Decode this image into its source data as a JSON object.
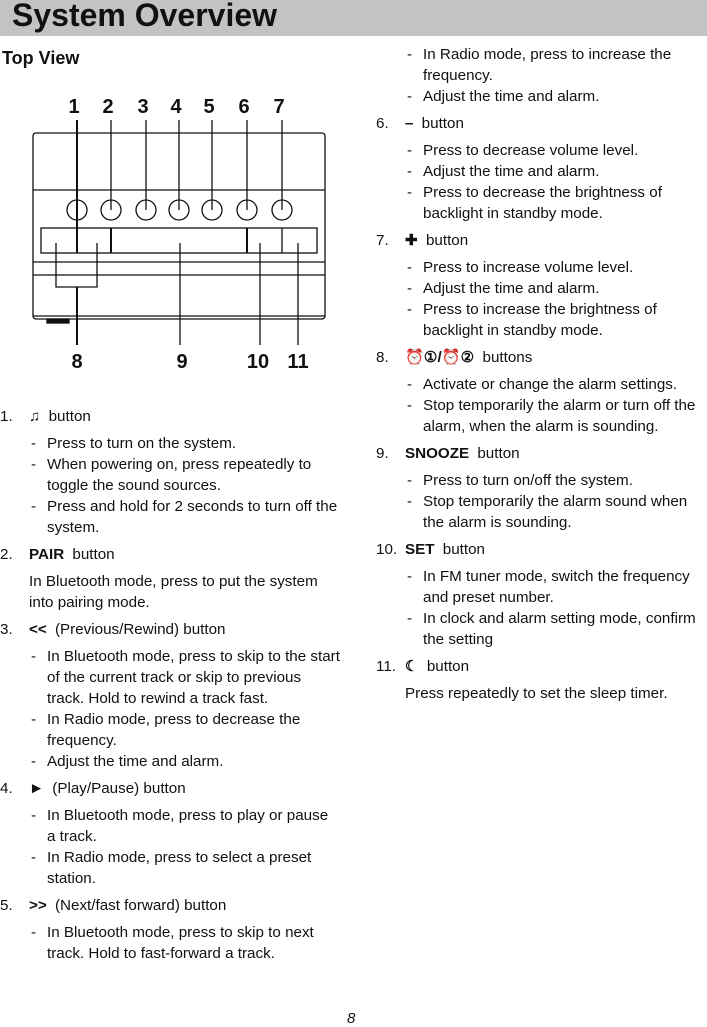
{
  "header": {
    "title": "System Overview"
  },
  "section": "Top View",
  "diagram": {
    "top_labels": [
      "1",
      "2",
      "3",
      "4",
      "5",
      "6",
      "7"
    ],
    "bottom_labels": [
      "8",
      "9",
      "10",
      "11"
    ]
  },
  "items": [
    {
      "num": "1.",
      "icon": "♫",
      "label": " button",
      "subs": [
        "Press to turn on the system.",
        "When powering on, press repeatedly to toggle the sound sources.",
        "Press and hold for 2 seconds to turn off the system."
      ]
    },
    {
      "num": "2.",
      "icon": "PAIR",
      "label": " button",
      "para": "In Bluetooth mode, press to put the system into pairing mode."
    },
    {
      "num": "3.",
      "icon": "<<",
      "label": " (Previous/Rewind) button",
      "subs": [
        "In Bluetooth mode, press to skip to the start of the current track or skip to previous track. Hold to rewind a track fast.",
        "In Radio mode, press to decrease the frequency.",
        "Adjust the time and alarm."
      ]
    },
    {
      "num": "4.",
      "icon": "►",
      "label": " (Play/Pause) button",
      "subs": [
        "In Bluetooth mode, press to play or pause a track.",
        "In Radio mode, press to select a preset station."
      ]
    },
    {
      "num": "5.",
      "icon": ">>",
      "label": " (Next/fast forward) button",
      "subs": [
        "In Bluetooth mode, press to skip to next track. Hold to fast-forward a track."
      ]
    },
    {
      "continued_subs": [
        "In Radio mode, press to increase the frequency.",
        "Adjust the time and alarm."
      ]
    },
    {
      "num": "6.",
      "icon": "–",
      "label": " button",
      "subs": [
        "Press to decrease volume level.",
        "Adjust the time and alarm.",
        "Press to decrease the brightness of backlight in standby mode."
      ]
    },
    {
      "num": "7.",
      "icon": "✚",
      "label": " button",
      "subs": [
        "Press to increase volume level.",
        "Adjust the time and alarm.",
        "Press to increase the brightness of backlight in standby mode."
      ]
    },
    {
      "num": "8.",
      "icon": "⏰①/⏰②",
      "label": " buttons",
      "subs": [
        "Activate or change the alarm settings.",
        "Stop temporarily the alarm or turn off the alarm, when the alarm is sounding."
      ]
    },
    {
      "num": "9.",
      "icon": "SNOOZE",
      "label": " button",
      "subs": [
        "Press to turn on/off the system.",
        "Stop temporarily the alarm sound when the alarm is sounding."
      ]
    },
    {
      "num": "10.",
      "icon": "SET",
      "label": " button",
      "subs": [
        "In FM tuner mode, switch the frequency and preset number.",
        "In clock and alarm setting mode, confirm the setting"
      ]
    },
    {
      "num": "11.",
      "icon": "☾",
      "label": " button",
      "para": "Press repeatedly to set the sleep timer."
    }
  ],
  "page_number": "8"
}
